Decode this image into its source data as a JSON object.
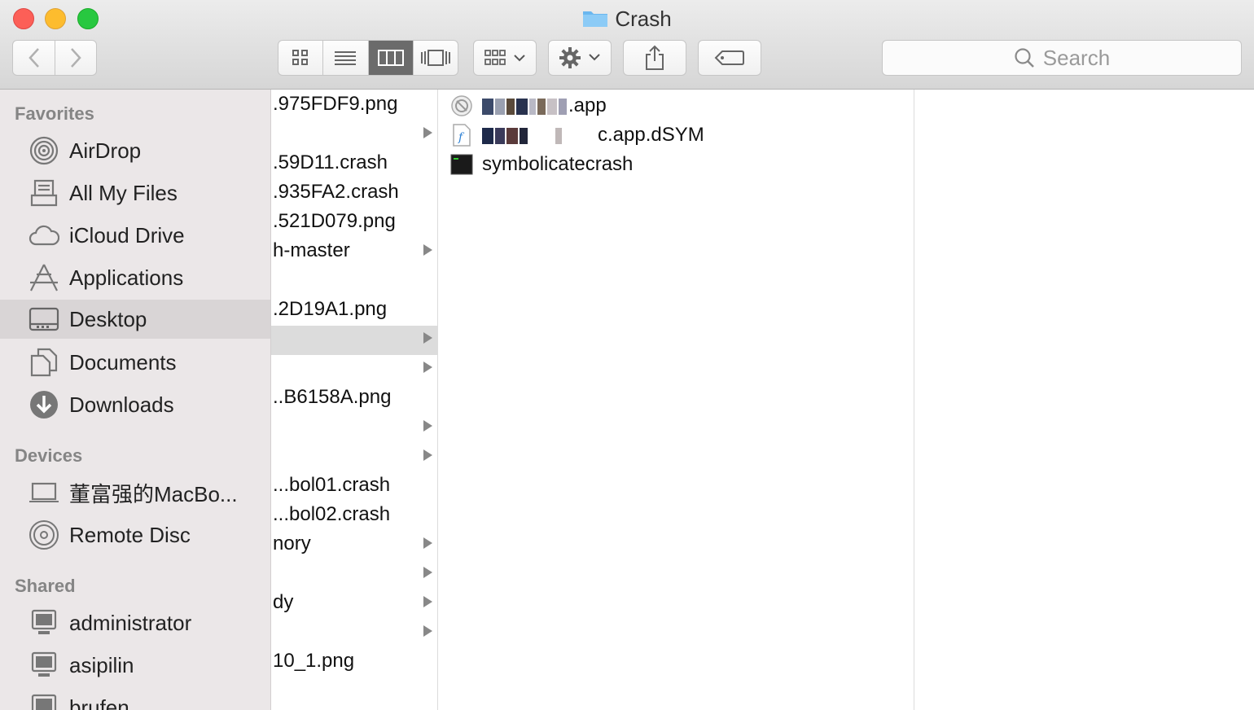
{
  "window": {
    "title": "Crash"
  },
  "toolbar": {
    "search_placeholder": "Search",
    "view_modes": [
      "icon-view",
      "list-view",
      "column-view",
      "cover-flow-view"
    ],
    "active_view": "column-view"
  },
  "sidebar": {
    "favorites_header": "Favorites",
    "favorites": [
      {
        "label": "AirDrop",
        "icon": "airdrop-icon"
      },
      {
        "label": "All My Files",
        "icon": "all-files-icon"
      },
      {
        "label": "iCloud Drive",
        "icon": "cloud-icon"
      },
      {
        "label": "Applications",
        "icon": "applications-icon"
      },
      {
        "label": "Desktop",
        "icon": "desktop-icon",
        "selected": true
      },
      {
        "label": "Documents",
        "icon": "documents-icon"
      },
      {
        "label": "Downloads",
        "icon": "downloads-icon"
      }
    ],
    "devices_header": "Devices",
    "devices": [
      {
        "label": "董富强的MacBo...",
        "icon": "laptop-icon"
      },
      {
        "label": "Remote Disc",
        "icon": "disc-icon"
      }
    ],
    "shared_header": "Shared",
    "shared": [
      {
        "label": "administrator",
        "icon": "computer-icon"
      },
      {
        "label": "asipilin",
        "icon": "computer-icon"
      },
      {
        "label": "brufen",
        "icon": "computer-icon"
      }
    ]
  },
  "column1": {
    "rows": [
      {
        "text": ".975FDF9.png",
        "arrow": false
      },
      {
        "text": "",
        "arrow": true
      },
      {
        "text": ".59D11.crash",
        "arrow": false
      },
      {
        "text": ".935FA2.crash",
        "arrow": false
      },
      {
        "text": ".521D079.png",
        "arrow": false
      },
      {
        "text": "h-master",
        "arrow": true
      },
      {
        "text": "",
        "arrow": false
      },
      {
        "text": ".2D19A1.png",
        "arrow": false
      },
      {
        "text": "",
        "arrow": true,
        "selected": true
      },
      {
        "text": "",
        "arrow": true
      },
      {
        "text": "..B6158A.png",
        "arrow": false
      },
      {
        "text": "",
        "arrow": true
      },
      {
        "text": "",
        "arrow": true
      },
      {
        "text": "...bol01.crash",
        "arrow": false
      },
      {
        "text": "...bol02.crash",
        "arrow": false
      },
      {
        "text": "nory",
        "arrow": true
      },
      {
        "text": "",
        "arrow": true
      },
      {
        "text": "dy",
        "arrow": true
      },
      {
        "text": "",
        "arrow": true
      },
      {
        "text": "10_1.png",
        "arrow": false
      }
    ]
  },
  "column2": {
    "items": [
      {
        "suffix": ".app",
        "icon": "app-icon"
      },
      {
        "suffix": "c.app.dSYM",
        "icon": "dsym-file-icon"
      },
      {
        "name": "symbolicatecrash",
        "icon": "terminal-exec-icon"
      }
    ]
  }
}
